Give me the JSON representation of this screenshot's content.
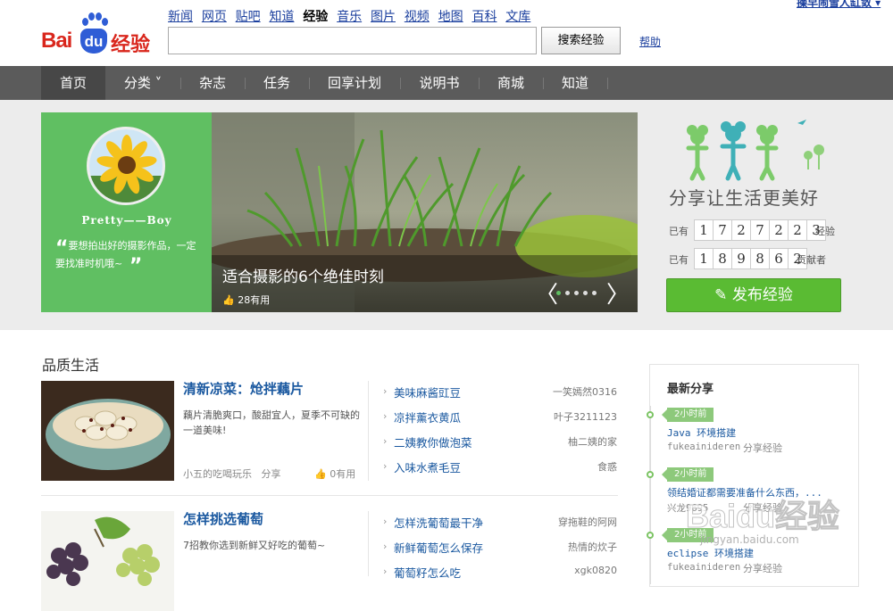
{
  "header": {
    "logo_bai": "Bai",
    "logo_du": "du",
    "logo_jingyan": "经验",
    "top_links": [
      "新闻",
      "网页",
      "贴吧",
      "知道",
      "经验",
      "音乐",
      "图片",
      "视频",
      "地图",
      "百科",
      "文库"
    ],
    "current_link": "经验",
    "user_link": "操早闹雪人缸敛 ▾",
    "search_value": "",
    "search_button": "搜索经验",
    "help": "帮助"
  },
  "nav": {
    "items": [
      "首页",
      "分类 ˅",
      "杂志",
      "任务",
      "回享计划",
      "说明书",
      "商城",
      "知道"
    ],
    "active": "首页"
  },
  "hero": {
    "user_name": "Pretty——Boy",
    "quote": "要想拍出好的摄影作品，一定要找准时机哦~",
    "slide_title": "适合摄影的6个绝佳时刻",
    "slide_likes": "28有用",
    "slogan": "分享让生活更美好",
    "exp_label": "已有",
    "exp_digits": [
      "1",
      "7",
      "2",
      "7",
      "2",
      "2",
      "3"
    ],
    "exp_suffix": "经验",
    "contrib_label": "已有",
    "contrib_digits": [
      "1",
      "8",
      "9",
      "8",
      "6",
      "2"
    ],
    "contrib_suffix": "贡献者",
    "publish_button": "发布经验",
    "prev_arrow": "〈",
    "next_arrow": "〉"
  },
  "section": {
    "title": "品质生活",
    "features": [
      {
        "title": "清新凉菜：炝拌藕片",
        "desc": "藕片清脆爽口，酸甜宜人，夏季不可缺的一道美味!",
        "author": "小五的吃喝玩乐",
        "share": "分享",
        "useful": "0有用"
      },
      {
        "title": "怎样挑选葡萄",
        "desc": "7招教你选到新鲜又好吃的葡萄~",
        "author": "",
        "share": "",
        "useful": ""
      }
    ],
    "list1": [
      {
        "title": "美味麻酱豇豆",
        "author": "一笑嫣然0316"
      },
      {
        "title": "凉拌薰衣黄瓜",
        "author": "叶子3211123"
      },
      {
        "title": "二姨教你做泡菜",
        "author": "柚二姨的家"
      },
      {
        "title": "入味水煮毛豆",
        "author": "食惑"
      }
    ],
    "list2": [
      {
        "title": "怎样洗葡萄最干净",
        "author": "穿拖鞋的阿网"
      },
      {
        "title": "新鲜葡萄怎么保存",
        "author": "热情的炊子"
      },
      {
        "title": "葡萄籽怎么吃",
        "author": "xgk0820"
      }
    ]
  },
  "latest": {
    "title": "最新分享",
    "items": [
      {
        "time": "2小时前",
        "title": "Java 环境搭建",
        "author": "fukeainideren",
        "mark": "分享经验"
      },
      {
        "time": "2小时前",
        "title": "领结婚证都需要准备什么东西，...",
        "author": "兴龙9695",
        "mark": "分享经验"
      },
      {
        "time": "2小时前",
        "title": "eclipse 环境搭建",
        "author": "fukeainideren",
        "mark": "分享经验"
      }
    ]
  },
  "watermark": {
    "text": "Baidu经验",
    "url": "jingyan.baidu.com"
  },
  "colors": {
    "brand_red": "#d9261c",
    "brand_blue": "#2f5dd6",
    "green": "#60bf62",
    "link_blue": "#1b59a0",
    "nav_bg": "#5b5b5b"
  }
}
